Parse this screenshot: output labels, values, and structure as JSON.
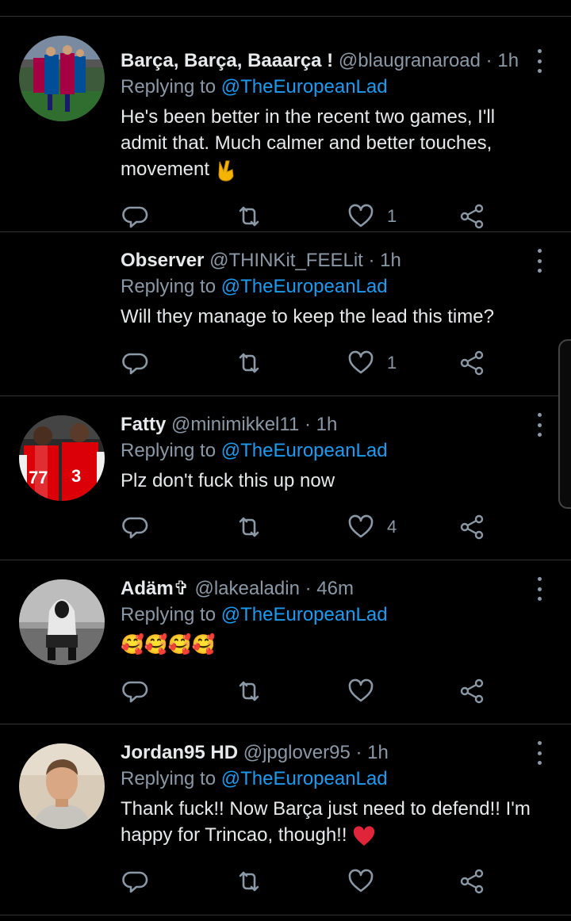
{
  "tweets": [
    {
      "name": "Barça, Barça, Baaarça !",
      "handle": "@blaugranaroad",
      "dot": "·",
      "time": "1h",
      "replying_prefix": "Replying to ",
      "mention": "@TheEuropeanLad",
      "text": "He's been better in the recent two games, I'll admit that. Much calmer and better touches, movement ",
      "emoji": "victory-hand-icon",
      "likes": "1",
      "avatar": "barca-players-avatar"
    },
    {
      "name": "Observer",
      "handle": "@THINKit_FEELit",
      "dot": "·",
      "time": "1h",
      "replying_prefix": "Replying to ",
      "mention": "@TheEuropeanLad",
      "text": "Will they manage to keep the lead this time?",
      "likes": "1"
    },
    {
      "name": "Fatty",
      "handle": "@minimikkel11",
      "dot": "·",
      "time": "1h",
      "replying_prefix": "Replying to ",
      "mention": "@TheEuropeanLad",
      "text": "Plz don't fuck this up now",
      "likes": "4",
      "avatar": "arsenal-players-avatar"
    },
    {
      "name": "Adäm✞",
      "handle": "@lakealadin",
      "dot": "·",
      "time": "46m",
      "replying_prefix": "Replying to ",
      "mention": "@TheEuropeanLad",
      "text": "🥰🥰🥰🥰",
      "likes": "",
      "avatar": "hooded-person-avatar"
    },
    {
      "name": "Jordan95 HD",
      "handle": "@jpglover95",
      "dot": "·",
      "time": "1h",
      "replying_prefix": "Replying to ",
      "mention": "@TheEuropeanLad",
      "text": "Thank fuck!! Now Barça just need to defend!! I'm happy for Trincao, though!! ",
      "emoji": "red-heart-icon",
      "likes": "",
      "avatar": "man-portrait-avatar"
    }
  ],
  "colors": {
    "background": "#000000",
    "text": "#e7e9ea",
    "muted": "#8b98a5",
    "mention": "#1d9bf0",
    "divider": "#2f3336"
  },
  "icons": {
    "reply": "reply-icon",
    "retweet": "retweet-icon",
    "like": "like-icon",
    "share": "share-icon",
    "more": "more-icon"
  }
}
